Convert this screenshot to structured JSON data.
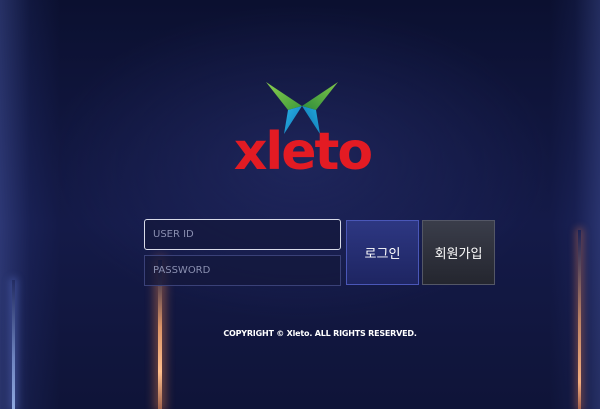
{
  "brand": {
    "name": "Xleto",
    "logo_text": "xleto",
    "colors": {
      "red": "#e31b23",
      "green": "#6cc04a",
      "blue": "#1aa3d9"
    }
  },
  "login": {
    "user_placeholder": "USER ID",
    "password_placeholder": "PASSWORD",
    "login_label": "로그인",
    "signup_label": "회원가입"
  },
  "footer": {
    "copyright": "COPYRIGHT © Xleto. ALL RIGHTS RESERVED."
  }
}
